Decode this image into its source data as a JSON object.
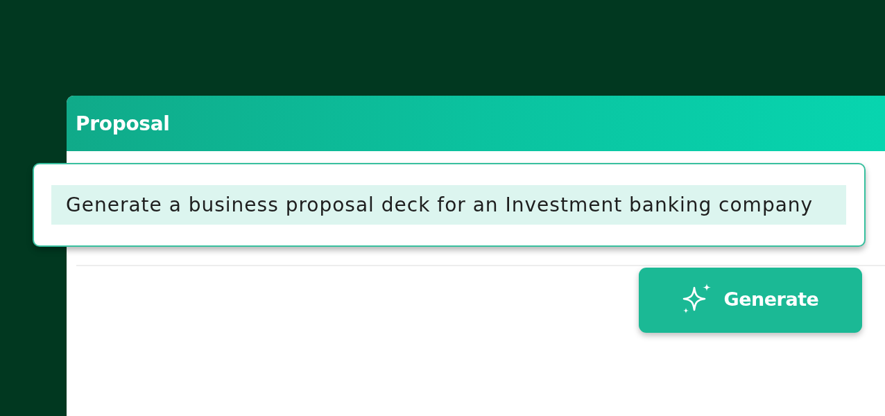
{
  "panel": {
    "title": "Proposal"
  },
  "prompt": {
    "value": "Generate a business proposal deck for an Investment banking company",
    "text_selected": true
  },
  "generate_button": {
    "label": "Generate"
  }
}
